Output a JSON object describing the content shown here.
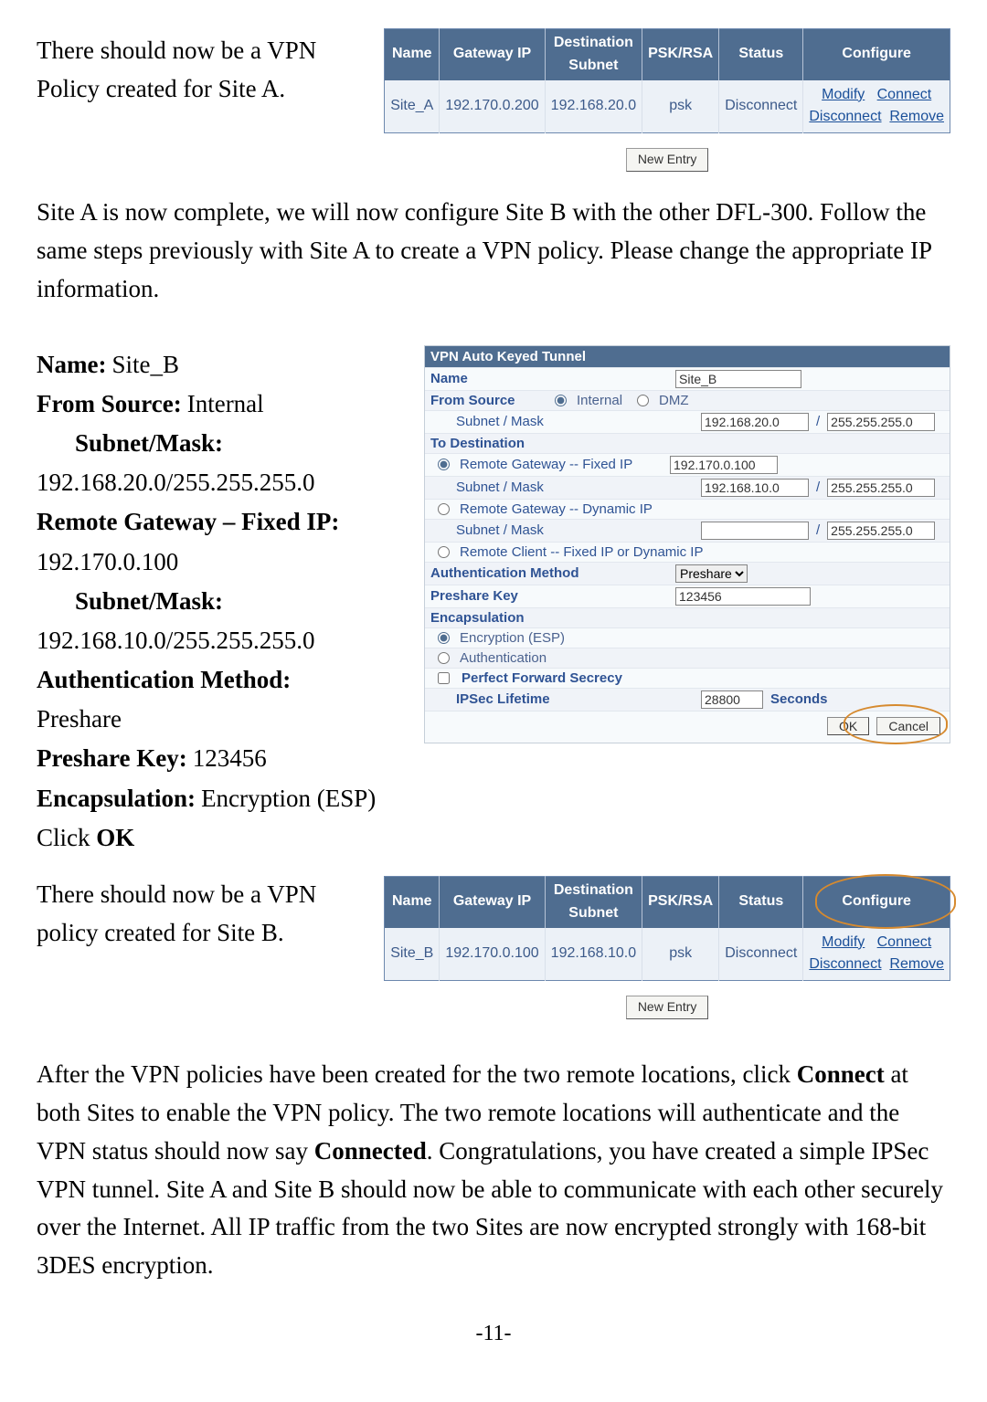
{
  "p1a": "There should now be a VPN Policy created for Site A.",
  "policy_headers": {
    "name": "Name",
    "gw": "Gateway IP",
    "dest": "Destination Subnet",
    "psk": "PSK/RSA",
    "status": "Status",
    "cfg": "Configure"
  },
  "policy_a": {
    "name": "Site_A",
    "gw": "192.170.0.200",
    "dest": "192.168.20.0",
    "psk": "psk",
    "status": "Disconnect",
    "links": {
      "modify": "Modify",
      "connect": "Connect",
      "disconnect": "Disconnect",
      "remove": "Remove"
    }
  },
  "new_entry": "New Entry",
  "p2": "Site A is now complete, we will now configure Site B with the other DFL-300. Follow the same steps previously with Site A to create a VPN policy. Please change the appropriate IP information.",
  "cfg": {
    "name_l": "Name:",
    "name_v": "Site_B",
    "from_l": "From Source:",
    "from_v": "Internal",
    "sub1_l": "Subnet/Mask:",
    "sub1_v": "192.168.20.0/255.255.255.0",
    "rg_l": "Remote Gateway – Fixed IP:",
    "rg_v": "192.170.0.100",
    "sub2_l": "Subnet/Mask:",
    "sub2_v": "192.168.10.0/255.255.255.0",
    "auth_l": "Authentication Method:",
    "auth_v": "Preshare",
    "pk_l": "Preshare Key:",
    "pk_v": "123456",
    "enc_l": "Encapsulation:",
    "enc_v": "Encryption (ESP)",
    "click": "Click ",
    "ok": "OK"
  },
  "form": {
    "title": "VPN Auto Keyed Tunnel",
    "name_l": "Name",
    "name_v": "Site_B",
    "from_l": "From Source",
    "from_r1": "Internal",
    "from_r2": "DMZ",
    "sub_l": "Subnet / Mask",
    "src_sub": "192.168.20.0",
    "src_mask": "255.255.255.0",
    "to_l": "To Destination",
    "rg_fixed": "Remote Gateway -- Fixed IP",
    "rg_fixed_v": "192.170.0.100",
    "rg_sub": "192.168.10.0",
    "rg_mask": "255.255.255.0",
    "rg_dyn": "Remote Gateway -- Dynamic IP",
    "rg_dyn_mask": "255.255.255.0",
    "rc": "Remote Client -- Fixed IP or Dynamic IP",
    "auth_l": "Authentication Method",
    "auth_v": "Preshare",
    "pk_l": "Preshare Key",
    "pk_v": "123456",
    "enc_l": "Encapsulation",
    "enc_r1": "Encryption (ESP)",
    "enc_r2": "Authentication",
    "pfs": "Perfect Forward Secrecy",
    "life_l": "IPSec Lifetime",
    "life_v": "28800",
    "life_u": "Seconds",
    "ok": "OK",
    "cancel": "Cancel"
  },
  "p3": "There should now be a VPN policy created for Site B.",
  "policy_b": {
    "name": "Site_B",
    "gw": "192.170.0.100",
    "dest": "192.168.10.0",
    "psk": "psk",
    "status": "Disconnect",
    "links": {
      "modify": "Modify",
      "connect": "Connect",
      "disconnect": "Disconnect",
      "remove": "Remove"
    }
  },
  "p4a": "After the VPN policies have been created for the two remote locations, click ",
  "p4b_bold": "Connect",
  "p4c": " at both Sites to enable the VPN policy. The two remote locations will authenticate and the VPN status should now say ",
  "p4d_bold": "Connected",
  "p4e": ". Congratulations, you have created a simple IPSec VPN tunnel. Site A and Site B should now be able to communicate with each other securely over the Internet. All IP traffic from the two Sites are now encrypted strongly with 168-bit 3DES encryption.",
  "page_no": "-11-"
}
